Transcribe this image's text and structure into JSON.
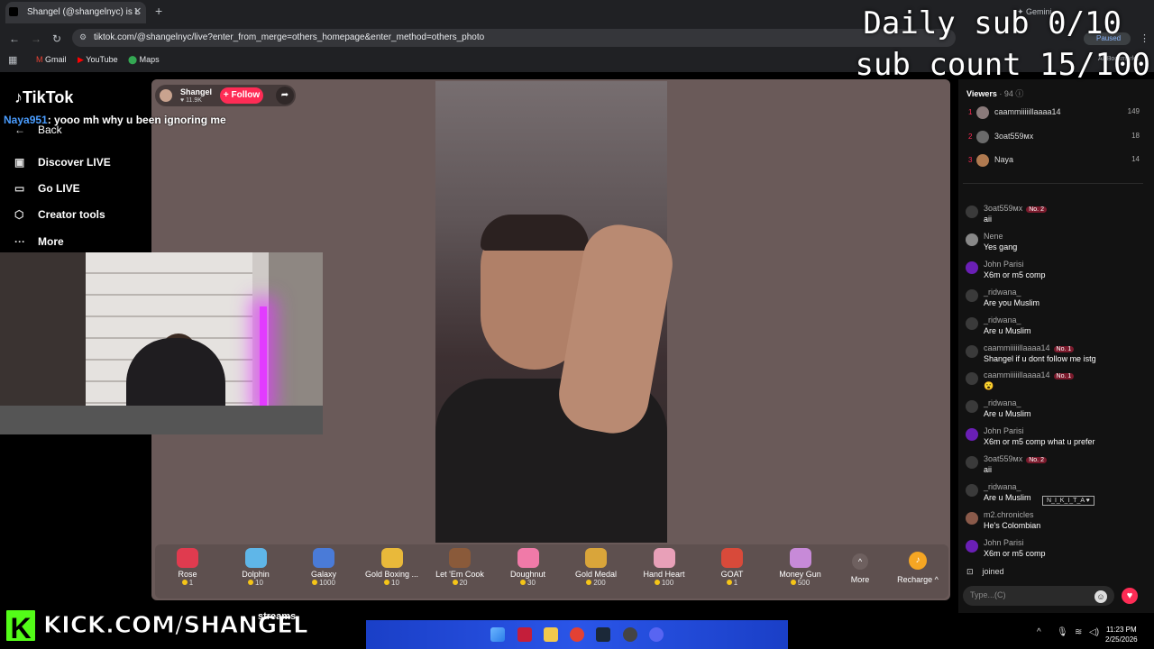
{
  "browser": {
    "tab_title": "Shangel (@shangelnyc) is L",
    "url": "tiktok.com/@shangelnyc/live?enter_from_merge=others_homepage&enter_method=others_photo",
    "bookmarks": [
      "Gmail",
      "YouTube",
      "Maps"
    ],
    "gemini": "Gemini",
    "profile_status": "Paused",
    "all_bookmarks": "All Bookmarks"
  },
  "sidebar": {
    "logo": "TikTok",
    "back": "Back",
    "items": [
      {
        "label": "Discover LIVE",
        "icon": "discover-icon"
      },
      {
        "label": "Go LIVE",
        "icon": "camera-icon"
      },
      {
        "label": "Creator tools",
        "icon": "lightbulb-icon"
      },
      {
        "label": "More",
        "icon": "more-icon"
      }
    ]
  },
  "overlay": {
    "chat_user": "Naya951",
    "chat_text": ": yooo mh why u been ignoring me",
    "daily_sub": "Daily sub 0/10",
    "sub_count": "sub count 15/100",
    "kick_url": "KICK.COM/SHANGEL",
    "kick_letter": "K",
    "streams_text": "streams"
  },
  "host": {
    "name": "Shangel",
    "likes": "11.9K",
    "follow_label": "+ Follow"
  },
  "gifts": [
    {
      "name": "Rose",
      "price": "1",
      "color": "#e03b4f"
    },
    {
      "name": "Dolphin",
      "price": "10",
      "color": "#5fb6e8"
    },
    {
      "name": "Galaxy",
      "price": "1000",
      "color": "#4a7bd8"
    },
    {
      "name": "Gold Boxing ...",
      "price": "10",
      "color": "#e9b93a"
    },
    {
      "name": "Let 'Em Cook",
      "price": "20",
      "color": "#8a5a3a"
    },
    {
      "name": "Doughnut",
      "price": "30",
      "color": "#f07aa8"
    },
    {
      "name": "Gold Medal",
      "price": "200",
      "color": "#d9a53a"
    },
    {
      "name": "Hand Heart",
      "price": "100",
      "color": "#e8a0b8"
    },
    {
      "name": "GOAT",
      "price": "1",
      "color": "#d84a3a"
    },
    {
      "name": "Money Gun",
      "price": "500",
      "color": "#c78ad8"
    }
  ],
  "gift_more": "More",
  "recharge": "Recharge",
  "viewers": {
    "header": "Viewers",
    "count": "94",
    "top": [
      {
        "rank": "1",
        "name": "caammiiiiillaaaa14",
        "score": "149"
      },
      {
        "rank": "2",
        "name": "3oat559мх",
        "score": "18"
      },
      {
        "rank": "3",
        "name": "Naya",
        "score": "14"
      }
    ]
  },
  "chat": [
    {
      "user": "3oat559мх",
      "badge": "No. 2",
      "text": "aii"
    },
    {
      "user": "Nene",
      "badge": "",
      "text": "Yes gang"
    },
    {
      "user": "John Parisi",
      "badge": "",
      "text": "X6m or m5 comp"
    },
    {
      "user": "_ridwana_",
      "badge": "",
      "text": "Are you Muslim"
    },
    {
      "user": "_ridwana_",
      "badge": "",
      "text": "Are u Muslim"
    },
    {
      "user": "caammiiiiillaaaa14",
      "badge": "No. 1",
      "text": "Shangel if u dont follow me istg"
    },
    {
      "user": "caammiiiiillaaaa14",
      "badge": "No. 1",
      "text": "😮"
    },
    {
      "user": "_ridwana_",
      "badge": "",
      "text": "Are u Muslim"
    },
    {
      "user": "John Parisi",
      "badge": "",
      "text": "X6m or m5 comp what u prefer"
    },
    {
      "user": "3oat559мх",
      "badge": "No. 2",
      "text": "aii"
    },
    {
      "user": "_ridwana_",
      "badge": "",
      "text": "Are u Muslim"
    },
    {
      "user": "m2.chronicles",
      "badge": "",
      "text": "He's Colombian"
    },
    {
      "user": "John Parisi",
      "badge": "",
      "text": "X6m or m5 comp"
    }
  ],
  "joined_text": "joined",
  "tooltip": "N_I_K_I_T_A",
  "chat_placeholder": "Type...(C)",
  "clock": {
    "time": "11:23 PM",
    "date": "2/25/2026"
  }
}
